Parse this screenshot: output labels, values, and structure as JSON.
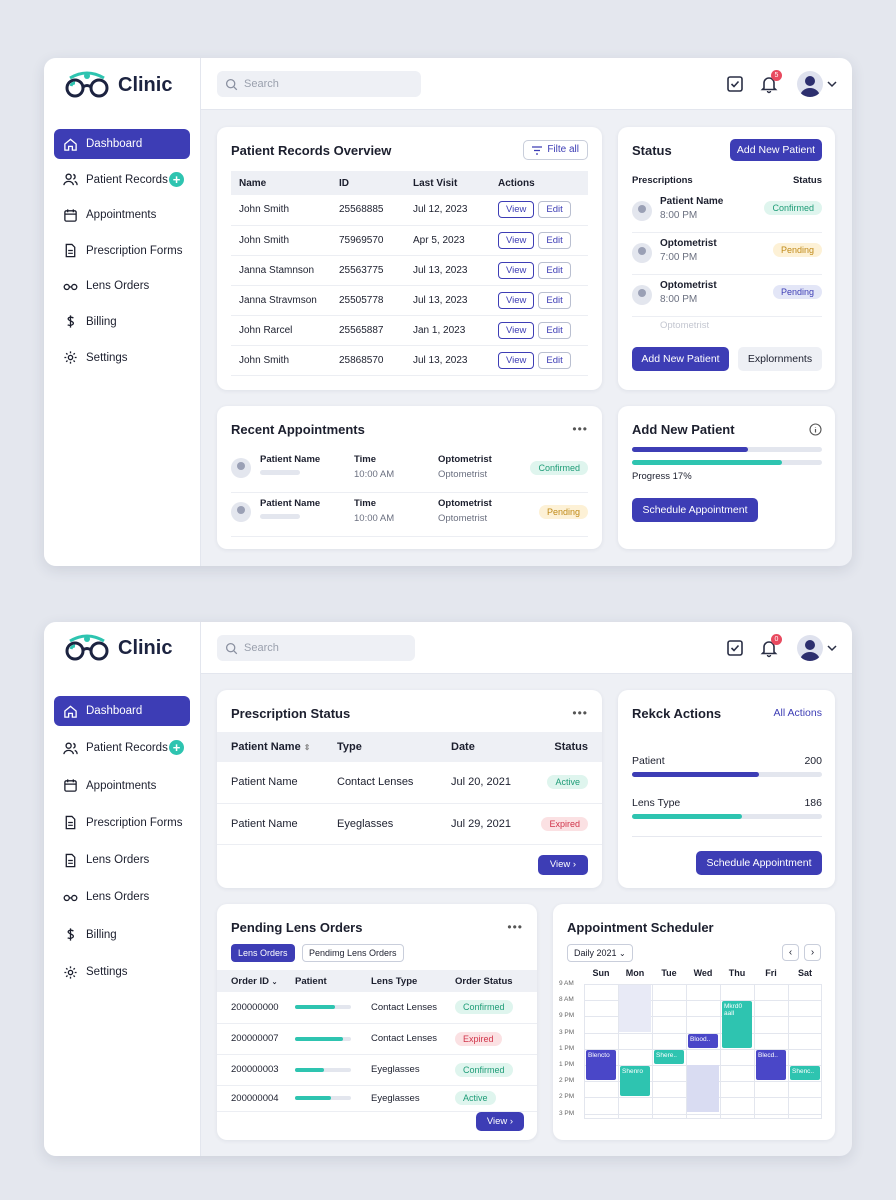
{
  "app": {
    "logo_text": "Clinic",
    "search_placeholder": "Search",
    "notif_count": "5",
    "notif_count2": "0"
  },
  "sidebar1": {
    "items": [
      {
        "label": "Dashboard",
        "icon": "home-icon"
      },
      {
        "label": "Patient Records",
        "icon": "users-icon"
      },
      {
        "label": "Appointments",
        "icon": "calendar-icon"
      },
      {
        "label": "Prescription Forms",
        "icon": "document-icon"
      },
      {
        "label": "Lens Orders",
        "icon": "glasses-icon"
      },
      {
        "label": "Billing",
        "icon": "dollar-icon"
      },
      {
        "label": "Settings",
        "icon": "gear-icon"
      }
    ]
  },
  "sidebar2": {
    "items": [
      {
        "label": "Dashboard",
        "icon": "home-icon"
      },
      {
        "label": "Patient Records",
        "icon": "users-icon"
      },
      {
        "label": "Appointments",
        "icon": "calendar-icon"
      },
      {
        "label": "Prescription Forms",
        "icon": "document-icon"
      },
      {
        "label": "Lens Orders",
        "icon": "document-icon"
      },
      {
        "label": "Lens Orders",
        "icon": "glasses-icon"
      },
      {
        "label": "Billing",
        "icon": "dollar-icon"
      },
      {
        "label": "Settings",
        "icon": "gear-icon"
      }
    ]
  },
  "records": {
    "title": "Patient Records Overview",
    "filter": "Filte all",
    "headers": [
      "Name",
      "ID",
      "Last Visit",
      "Actions"
    ],
    "view": "View",
    "edit": "Edit",
    "rows": [
      {
        "name": "John Smith",
        "id": "25568885",
        "date": "Jul 12, 2023"
      },
      {
        "name": "John Smith",
        "id": "75969570",
        "date": "Apr 5, 2023"
      },
      {
        "name": "Janna Stamnson",
        "id": "25563775",
        "date": "Jul 13, 2023"
      },
      {
        "name": "Janna Stravmson",
        "id": "25505778",
        "date": "Jul 13, 2023"
      },
      {
        "name": "John Rarcel",
        "id": "25565887",
        "date": "Jan 1, 2023"
      },
      {
        "name": "John Smith",
        "id": "25868570",
        "date": "Jul 13, 2023"
      }
    ]
  },
  "status": {
    "title": "Status",
    "add_btn": "Add New Patient",
    "col1": "Prescriptions",
    "col2": "Status",
    "rows": [
      {
        "name": "Patient Name",
        "time": "8:00 PM",
        "status": "Confirmed"
      },
      {
        "name": "Optometrist",
        "time": "7:00 PM",
        "status": "Pending"
      },
      {
        "name": "Optometrist",
        "time": "8:00 PM",
        "status": "Pending"
      }
    ],
    "faded": "Optometrist",
    "btn1": "Add New Patient",
    "btn2": "Explornments"
  },
  "recent": {
    "title": "Recent Appointments",
    "rows": [
      {
        "name": "Patient Name",
        "tlabel": "Time",
        "time": "10:00 AM",
        "olabel": "Optometrist",
        "opt": "Optometrist",
        "status": "Confirmed"
      },
      {
        "name": "Patient Name",
        "tlabel": "Time",
        "time": "10:00 AM",
        "olabel": "Optometrist",
        "opt": "Optometrist",
        "status": "Pending"
      }
    ]
  },
  "addnew": {
    "title": "Add New Patient",
    "progress_label": "Progress 17%",
    "progress": 0.17,
    "btn": "Schedule Appointment"
  },
  "rx": {
    "title": "Prescription Status",
    "headers": [
      "Patient Name",
      "Type",
      "Date",
      "Status"
    ],
    "rows": [
      {
        "name": "Patient Name",
        "type": "Contact Lenses",
        "date": "Jul 20, 2021",
        "status": "Active"
      },
      {
        "name": "Patient Name",
        "type": "Eyeglasses",
        "date": "Jul 29, 2021",
        "status": "Expired"
      }
    ],
    "view": "View"
  },
  "quick": {
    "title": "Rekck Actions",
    "link": "All Actions",
    "patient_label": "Patient",
    "patient_val": "200",
    "patient_frac": 0.67,
    "lens_label": "Lens Type",
    "lens_val": "186",
    "lens_frac": 0.58,
    "btn": "Schedule Appointment"
  },
  "pending": {
    "title": "Pending Lens Orders",
    "tab1": "Lens Orders",
    "tab2": "Pendimg Lens Orders",
    "headers": [
      "Order ID",
      "Patient",
      "Lens Type",
      "Order Status"
    ],
    "rows": [
      {
        "id": "200000000",
        "lens": "Contact Lenses",
        "status": "Confirmed",
        "frac": 0.72
      },
      {
        "id": "200000007",
        "lens": "Contact Lenses",
        "status": "Expired",
        "frac": 0.85
      },
      {
        "id": "200000003",
        "lens": "Eyeglasses",
        "status": "Confirmed",
        "frac": 0.52
      },
      {
        "id": "200000004",
        "lens": "Eyeglasses",
        "status": "Active",
        "frac": 0.65
      }
    ],
    "view": "View"
  },
  "sched": {
    "title": "Appointment Scheduler",
    "range": "Daily 2021",
    "days": [
      "Sun",
      "Mon",
      "Tue",
      "Wed",
      "Thu",
      "Fri",
      "Sat"
    ],
    "times": [
      "9 AM",
      "8 AM",
      "9 PM",
      "3 PM",
      "1 PM",
      "1 PM",
      "2 PM",
      "2 PM",
      "3 PM"
    ],
    "events": [
      "Blencto",
      "Shenro",
      "Shere..",
      "Blood..",
      "Mkrd0 aall",
      "Blecd..",
      "Shenc.."
    ]
  },
  "colors": {
    "primary": "#3d3db5",
    "teal": "#2ec4b0"
  }
}
